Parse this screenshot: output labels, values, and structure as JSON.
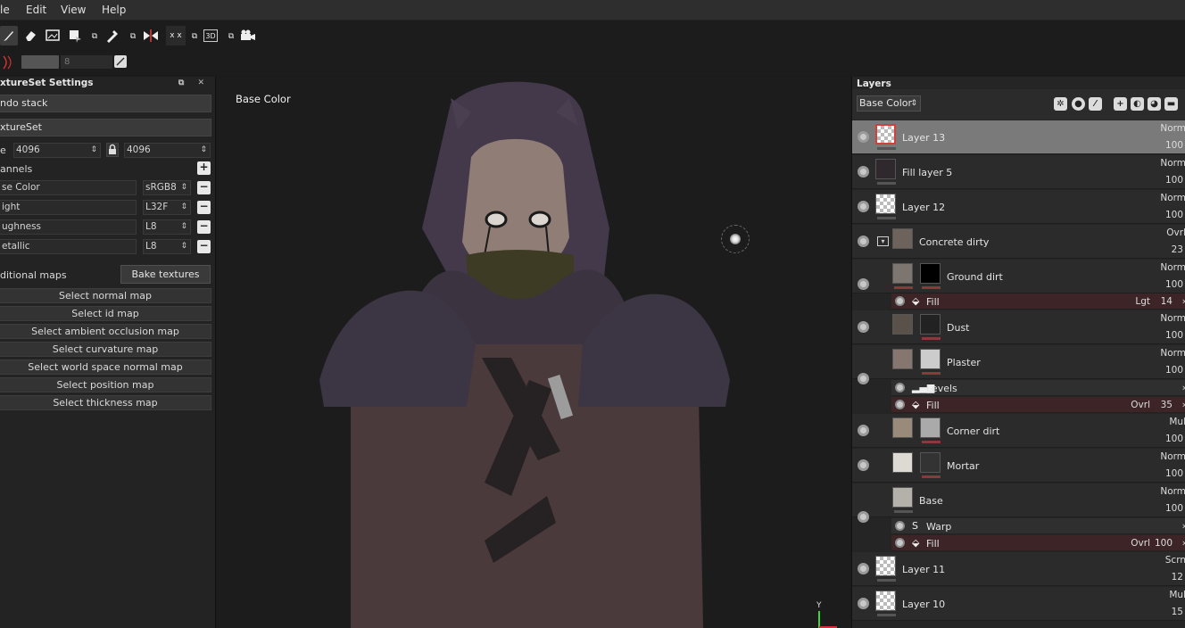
{
  "menubar": {
    "items": [
      "le",
      "Edit",
      "View",
      "Help"
    ]
  },
  "toolbar": {
    "tools": [
      {
        "icon": "paint-brush-icon",
        "glyph": "🖌"
      },
      {
        "icon": "eraser-icon",
        "glyph": "◈"
      },
      {
        "icon": "projection-icon",
        "glyph": "▣"
      },
      {
        "icon": "polygon-fill-icon",
        "glyph": "◪"
      },
      {
        "icon": "color-picker-icon",
        "glyph": "✎"
      },
      {
        "icon": "symmetry-icon",
        "glyph": "⧓"
      },
      {
        "icon": "xy-symmetry-icon",
        "glyph": "x x"
      },
      {
        "icon": "3d-view-icon",
        "glyph": "3D"
      },
      {
        "icon": "camera-icon",
        "glyph": "◙"
      }
    ],
    "size_value": "8"
  },
  "left_panel": {
    "title": "xtureSet Settings",
    "undo_stack": "ndo stack",
    "textureset": "xtureSet",
    "size_label": "e",
    "size_w": "4096",
    "size_h": "4096",
    "channels_label": "annels",
    "channels": [
      {
        "name": "se Color",
        "format": "sRGB8"
      },
      {
        "name": "ight",
        "format": "L32F"
      },
      {
        "name": "ughness",
        "format": "L8"
      },
      {
        "name": "etallic",
        "format": "L8"
      }
    ],
    "additional_maps": "ditional maps",
    "bake_button": "Bake textures",
    "maps": [
      "Select normal map",
      "Select id map",
      "Select ambient occlusion map",
      "Select curvature map",
      "Select world space normal map",
      "Select position map",
      "Select thickness map"
    ]
  },
  "viewport": {
    "label": "Base Color",
    "axis_y": "Y"
  },
  "layers_panel": {
    "title": "Layers",
    "channel": "Base Color",
    "layers": [
      {
        "name": "Layer 13",
        "blend": "Norm",
        "opacity": "100"
      },
      {
        "name": "Fill layer 5",
        "blend": "Norm",
        "opacity": "100"
      },
      {
        "name": "Layer 12",
        "blend": "Norm",
        "opacity": "100"
      },
      {
        "name": "Concrete dirty",
        "blend": "Ovrl",
        "opacity": "23"
      },
      {
        "name": "Ground dirt",
        "blend": "Norm",
        "opacity": "100"
      },
      {
        "name": "Dust",
        "blend": "Norm",
        "opacity": "100"
      },
      {
        "name": "Plaster",
        "blend": "Norm",
        "opacity": "100"
      },
      {
        "name": "Corner dirt",
        "blend": "Mul",
        "opacity": "100"
      },
      {
        "name": "Mortar",
        "blend": "Norm",
        "opacity": "100"
      },
      {
        "name": "Base",
        "blend": "Norm",
        "opacity": "100"
      },
      {
        "name": "Layer 11",
        "blend": "Scrn",
        "opacity": "12"
      },
      {
        "name": "Layer 10",
        "blend": "Mul",
        "opacity": "15"
      }
    ],
    "effects": {
      "ground_fill": {
        "label": "Fill",
        "blend": "Lgt",
        "opacity": "14"
      },
      "plaster_levels": {
        "label": "Levels"
      },
      "plaster_fill": {
        "label": "Fill",
        "blend": "Ovrl",
        "opacity": "35"
      },
      "base_warp": {
        "label": "Warp"
      },
      "base_fill": {
        "label": "Fill",
        "blend": "Ovrl",
        "opacity": "100"
      }
    }
  },
  "colors": {
    "accent_red": "#d04040",
    "effect_row": "#3d2427",
    "selected_layer": "#7a7a7a"
  }
}
